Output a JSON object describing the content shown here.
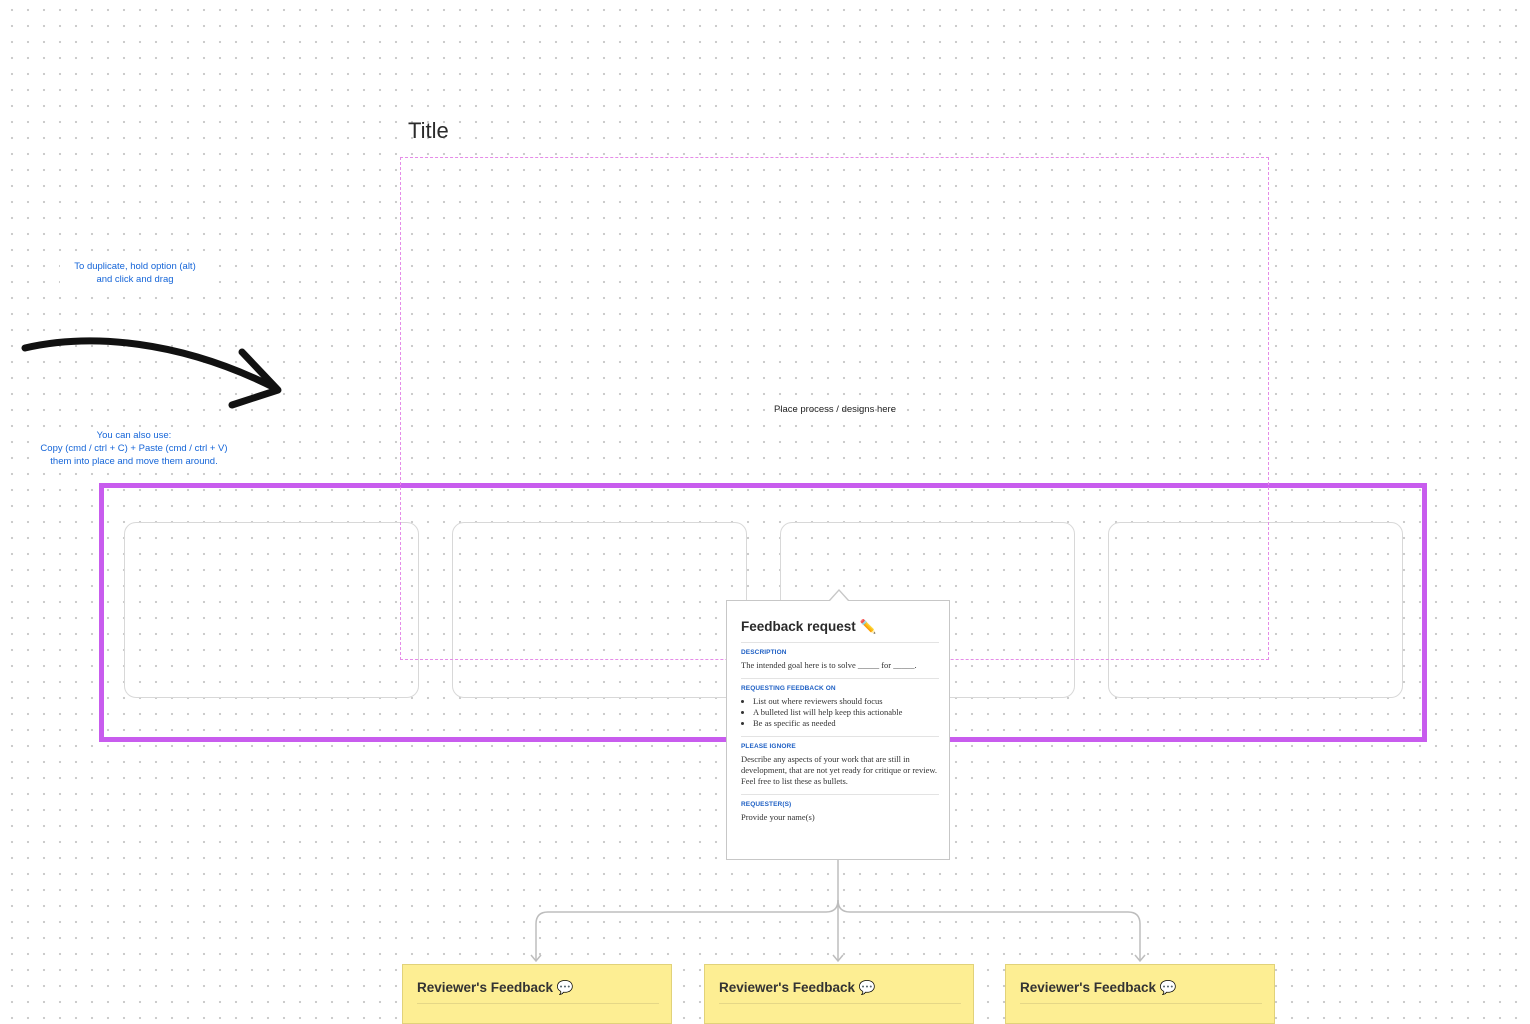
{
  "board": {
    "title": "Title",
    "design_area_label": "Place process / designs here"
  },
  "hints": {
    "duplicate_line1": "To duplicate, hold option (alt)",
    "duplicate_line2": "and click and drag",
    "copy_line1": "You can also use:",
    "copy_line2": "Copy (cmd / ctrl + C) + Paste (cmd / ctrl + V)",
    "copy_line3": "them into place and move them around."
  },
  "feedback_request": {
    "title": "Feedback request ✏️",
    "sections": [
      {
        "label": "DESCRIPTION",
        "text": "The intended goal here is to solve _____ for _____."
      },
      {
        "label": "REQUESTING FEEDBACK ON",
        "bullets": [
          "List out where reviewers should focus",
          "A bulleted list will help keep this actionable",
          "Be as specific as needed"
        ]
      },
      {
        "label": "PLEASE IGNORE",
        "text": "Describe any aspects of your work that are still in development, that are not yet ready for critique or review. Feel free to list these as bullets."
      },
      {
        "label": "REQUESTER(S)",
        "text": "Provide your name(s)"
      }
    ]
  },
  "reviewer_cards": [
    {
      "title": "Reviewer's Feedback 💬"
    },
    {
      "title": "Reviewer's Feedback 💬"
    },
    {
      "title": "Reviewer's Feedback 💬"
    }
  ],
  "colors": {
    "accent_purple": "#c85cee",
    "dashed_pink": "#e58be8",
    "hint_blue": "#1565d8",
    "sticky_yellow": "#fdee93"
  }
}
